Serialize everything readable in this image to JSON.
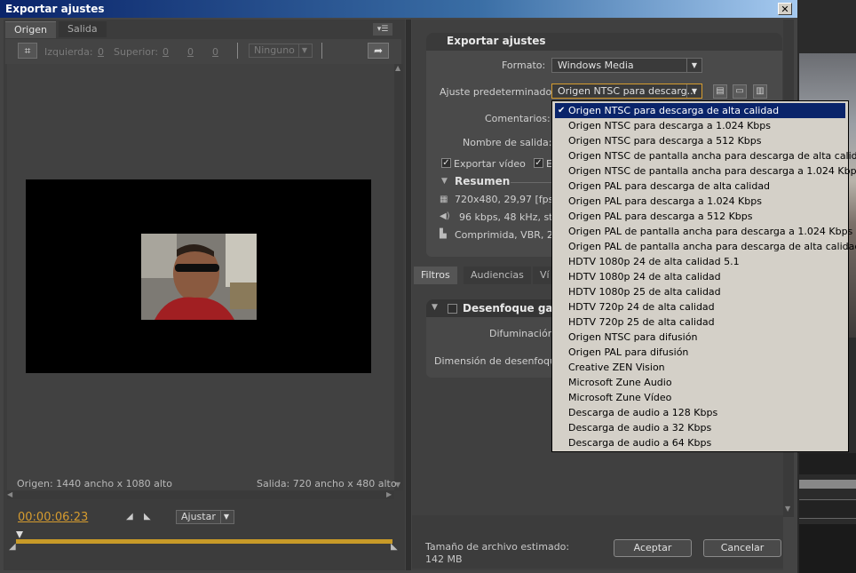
{
  "window": {
    "title": "Exportar ajustes",
    "close_glyph": "✕"
  },
  "left": {
    "tabs": [
      "Origen",
      "Salida"
    ],
    "crop_fields": {
      "left_label": "Izquierda:",
      "left_value": "0",
      "top_label": "Superior:",
      "top_value": "0",
      "right_value": "0",
      "bottom_value": "0"
    },
    "crop_ratio": "Ninguno",
    "origin_info": "Origen: 1440 ancho x 1080 alto",
    "output_info": "Salida: 720 ancho x 480 alto",
    "timecode": "00:00:06:23",
    "fit_option": "Ajustar",
    "playback_progress": 1.0
  },
  "settings": {
    "header": "Exportar ajustes",
    "format_label": "Formato:",
    "format_value": "Windows Media",
    "preset_label": "Ajuste predeterminado:",
    "preset_value": "Origen NTSC para descarg...",
    "comments_label": "Comentarios:",
    "output_name_label": "Nombre de salida:",
    "export_video_label": "Exportar vídeo",
    "export_audio_label_partial": "E",
    "summary_label": "Resumen",
    "summary_lines": [
      "720x480, 29,97 [fps]",
      "96 kbps, 48 kHz, ster",
      "Comprimida, VBR, 2 pa"
    ]
  },
  "filters": {
    "tabs": [
      "Filtros",
      "Audiencias",
      "Ví"
    ],
    "blur_title": "Desenfoque gaus",
    "blur_label": "Difuminación:",
    "blur_dimension_label": "Dimensión de desenfoque:"
  },
  "footer": {
    "size_label": "Tamaño de archivo estimado:",
    "size_value": "142 MB",
    "accept": "Aceptar",
    "cancel": "Cancelar"
  },
  "preset_options": [
    "Origen NTSC para descarga de alta calidad",
    "Origen NTSC para descarga a 1.024 Kbps",
    "Origen NTSC para descarga a 512 Kbps",
    "Origen NTSC de pantalla ancha para descarga de alta calidad",
    "Origen NTSC de pantalla ancha para descarga a 1.024 Kbps",
    "Origen PAL para descarga de alta calidad",
    "Origen PAL para descarga a 1.024 Kbps",
    "Origen PAL para descarga a 512 Kbps",
    "Origen PAL de pantalla ancha para descarga a 1.024 Kbps",
    "Origen PAL de pantalla ancha para descarga de alta calidad",
    "HDTV 1080p 24 de alta calidad 5.1",
    "HDTV 1080p 24 de alta calidad",
    "HDTV 1080p 25 de alta calidad",
    "HDTV 720p 24 de alta calidad",
    "HDTV 720p 25 de alta calidad",
    "Origen NTSC para difusión",
    "Origen PAL para difusión",
    "Creative ZEN Vision",
    "Microsoft Zune Audio",
    "Microsoft Zune Vídeo",
    "Descarga de audio a 128 Kbps",
    "Descarga de audio a 32 Kbps",
    "Descarga de audio a 64 Kbps"
  ],
  "selected_preset_index": 0,
  "colors": {
    "accent": "#d69c2f",
    "selection": "#0a246a",
    "titlebar": "#0a246a"
  }
}
